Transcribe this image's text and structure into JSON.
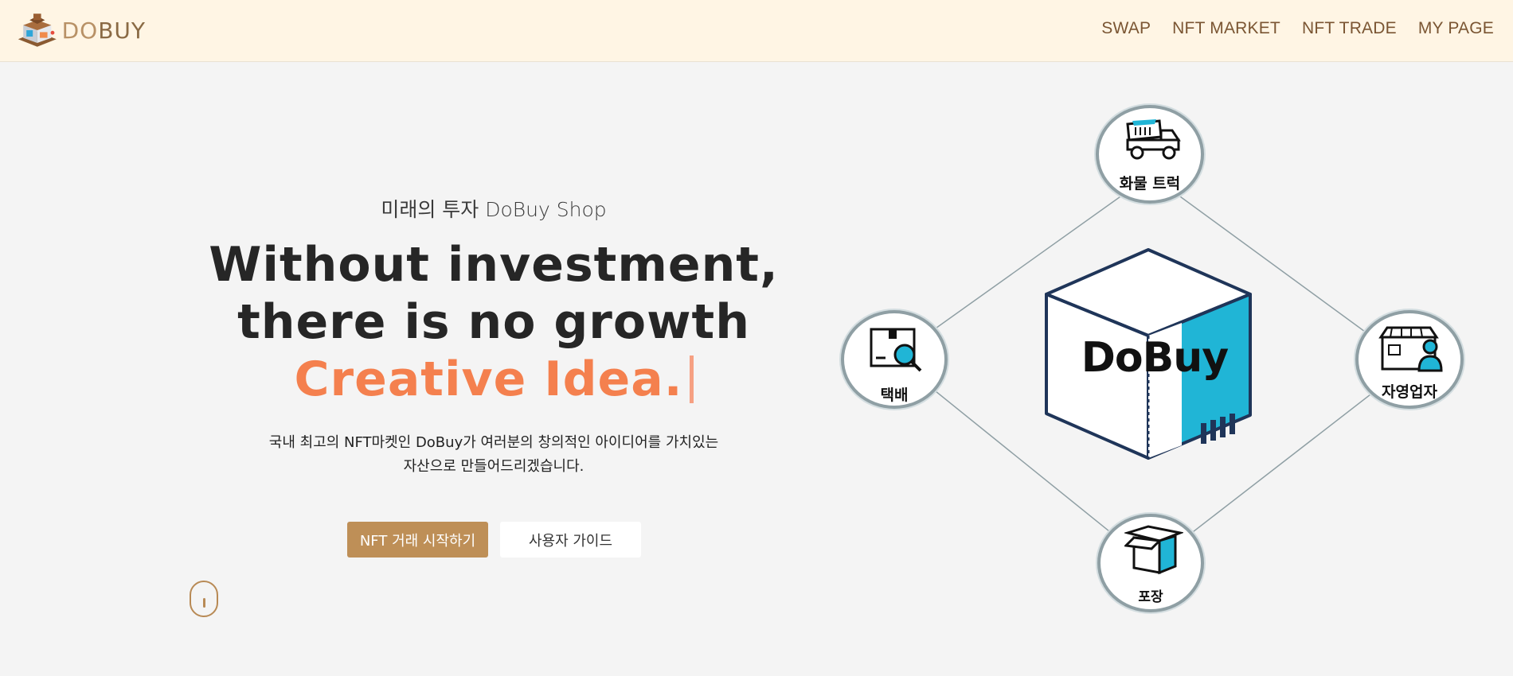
{
  "header": {
    "logo_text_do": "DO",
    "logo_text_buy": "BUY",
    "nav": [
      "SWAP",
      "NFT MARKET",
      "NFT TRADE",
      "MY PAGE"
    ]
  },
  "hero": {
    "subtitle": "미래의 투자 DoBuy Shop",
    "line1": "Without investment,",
    "line2": "there is no growth",
    "line3": "Creative Idea.",
    "desc_line1": "국내 최고의 NFT마켓인 DoBuy가 여러분의 창의적인 아이디어를 가치있는",
    "desc_line2": "자산으로 만들어드리겠습니다.",
    "primary_button": "NFT 거래 시작하기",
    "secondary_button": "사용자 가이드"
  },
  "diagram": {
    "center_label": "DoBuy",
    "nodes": {
      "top": "화물 트럭",
      "left": "택배",
      "right": "자영업자",
      "bottom": "포장"
    },
    "icons": {
      "top": "dump-truck-icon",
      "left": "parcel-search-icon",
      "right": "store-owner-icon",
      "bottom": "open-box-icon",
      "center": "dobuy-cube"
    }
  },
  "colors": {
    "header_bg": "#fff5e4",
    "nav_text": "#7a5532",
    "accent_orange": "#f4804e",
    "primary_button": "#be8f57",
    "cyan": "#1fb6d6"
  }
}
